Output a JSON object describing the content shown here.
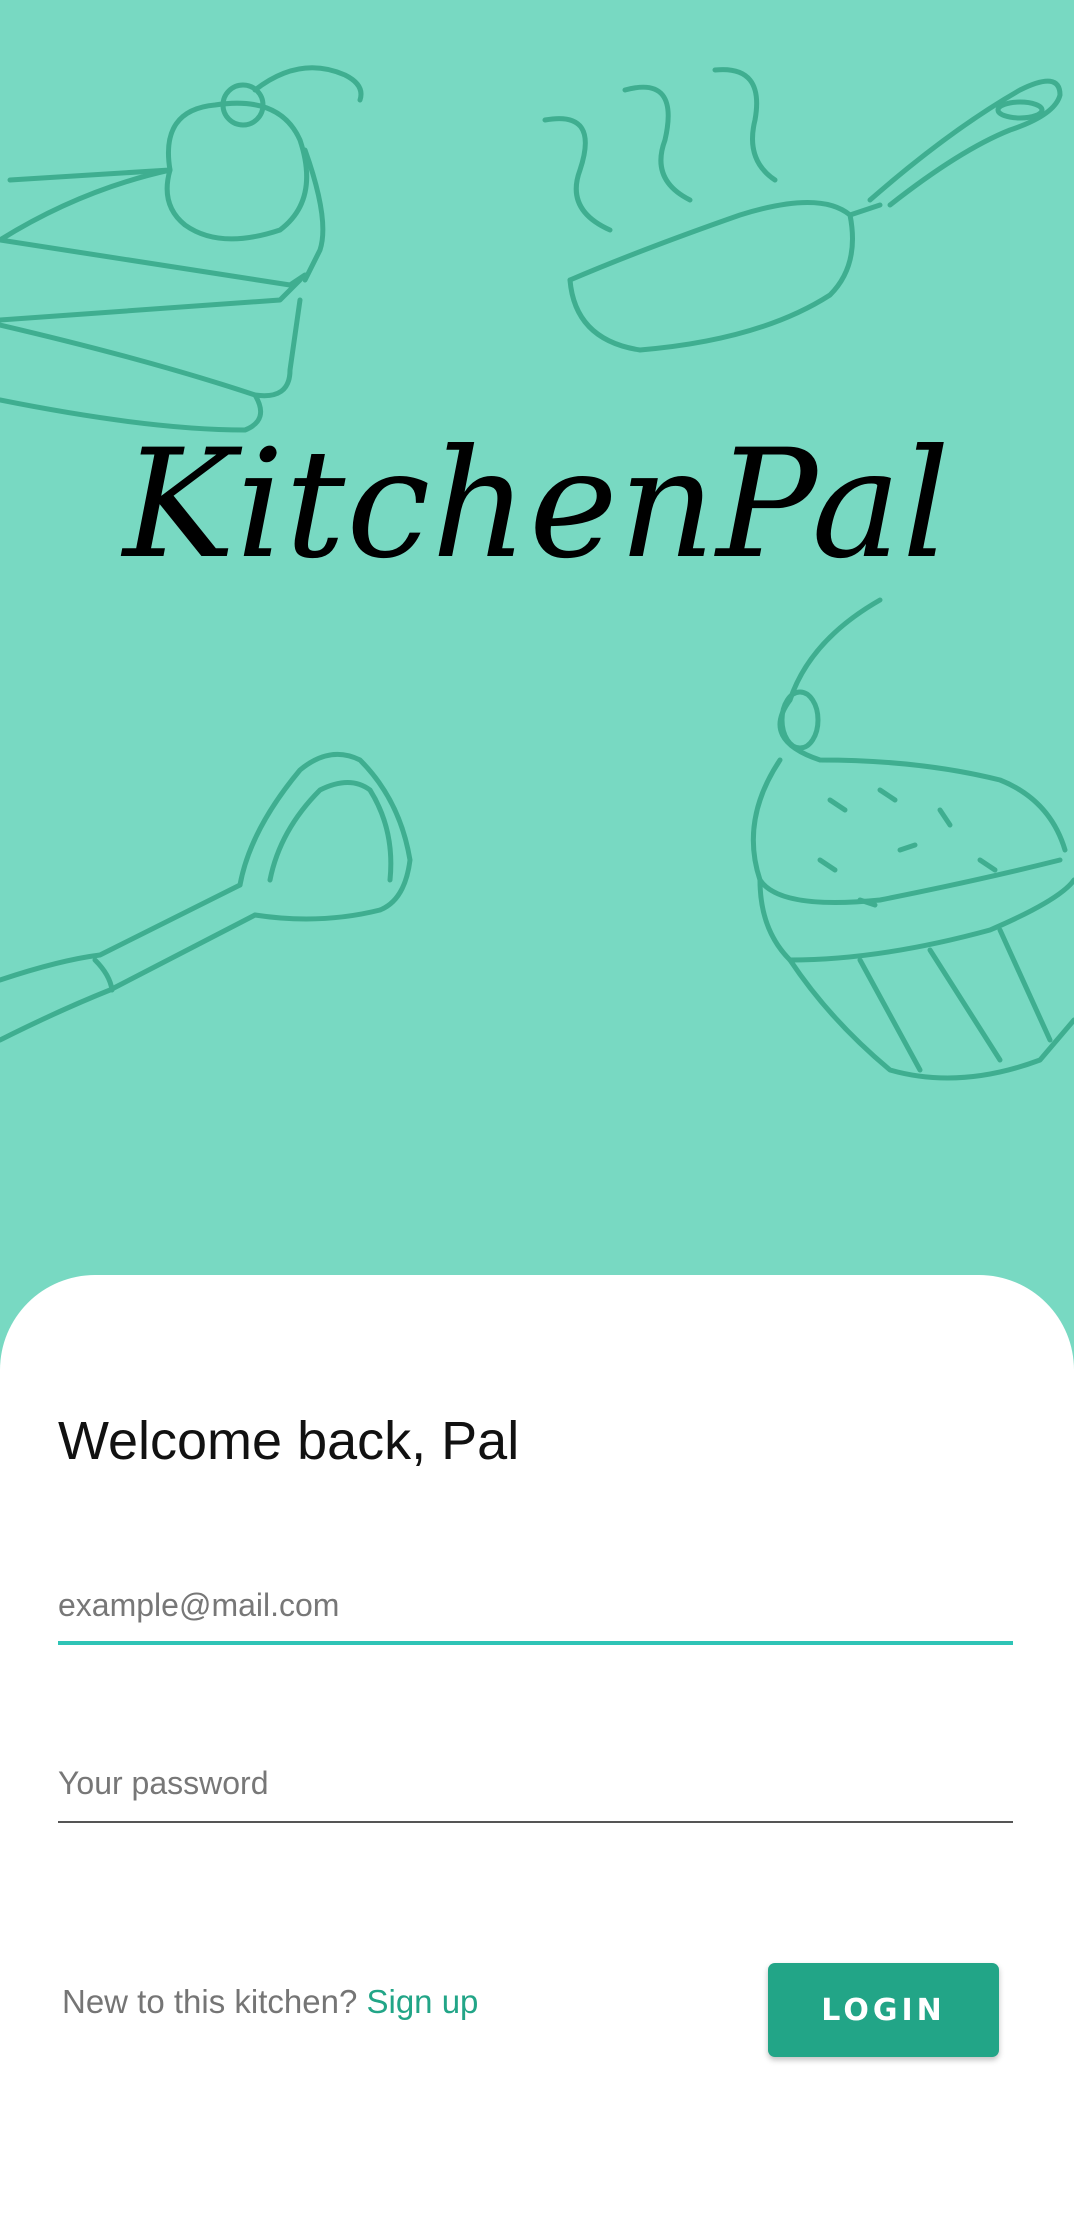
{
  "app": {
    "title": "KitchenPal",
    "accent_color": "#22a587",
    "hero_color": "#78d9c2"
  },
  "login": {
    "greeting": "Welcome back, Pal",
    "email_placeholder": "example@mail.com",
    "email_value": "",
    "password_placeholder": "Your password",
    "password_value": "",
    "signup_prompt": "New to this kitchen?",
    "signup_link": "Sign up",
    "login_button": "LOGIN"
  },
  "decor": {
    "icons": [
      "cake-slice-icon",
      "frying-pan-icon",
      "spatula-icon",
      "cupcake-icon"
    ]
  }
}
